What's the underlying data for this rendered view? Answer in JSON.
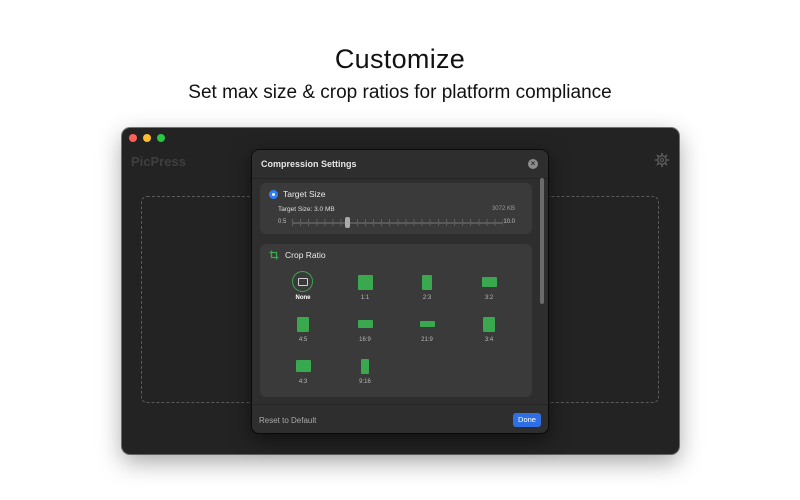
{
  "promo": {
    "headline": "Customize",
    "subhead": "Set max size & crop ratios for platform compliance"
  },
  "window": {
    "app_title": "PicPress",
    "settings_icon": "gear-icon"
  },
  "dialog": {
    "title": "Compression Settings",
    "close_icon": "close-icon",
    "target_size": {
      "title": "Target Size",
      "selected": true,
      "label": "Target Size: 3.0 MB",
      "max_kb": "3072 KB",
      "range_min": "0.5",
      "range_max": "10.0",
      "value_mb": 3.0,
      "min_mb": 0.5,
      "max_mb": 10.0
    },
    "crop_ratio": {
      "title": "Crop Ratio",
      "icon": "crop-icon",
      "selected": "None",
      "options": [
        {
          "label": "None"
        },
        {
          "label": "1:1"
        },
        {
          "label": "2:3"
        },
        {
          "label": "3:2"
        },
        {
          "label": "4:5"
        },
        {
          "label": "16:9"
        },
        {
          "label": "21:9"
        },
        {
          "label": "3:4"
        },
        {
          "label": "4:3"
        },
        {
          "label": "9:16"
        }
      ]
    },
    "reset_label": "Reset to Default",
    "done_label": "Done"
  },
  "colors": {
    "accent_green": "#39a84e",
    "accent_blue": "#2f6fe6"
  }
}
